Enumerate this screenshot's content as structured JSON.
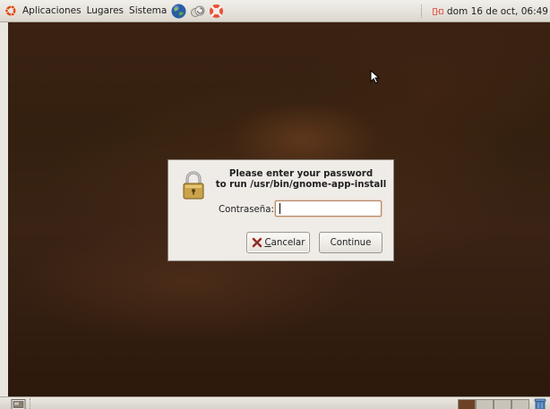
{
  "top_panel": {
    "menus": [
      "Aplicaciones",
      "Lugares",
      "Sistema"
    ],
    "launchers": [
      "web-browser-icon",
      "update-icon",
      "help-lifebuoy-icon"
    ],
    "clock": "dom 16 de oct, 06:49"
  },
  "dialog": {
    "title_line1": "Please enter your password",
    "title_line2": "to run /usr/bin/gnome-app-install",
    "password_label": "Contraseña:",
    "password_value": "",
    "cancel_label": "Cancelar",
    "cancel_mnemonic": "C",
    "continue_label": "Continue",
    "icon": "lock-icon"
  },
  "bottom_panel": {
    "workspaces": 4,
    "active_workspace": 1
  },
  "colors": {
    "panel_bg": "#e4e0d9",
    "desktop_bg": "#3a2214",
    "dialog_bg": "#efebe7",
    "active_workspace": "#6d4126"
  }
}
